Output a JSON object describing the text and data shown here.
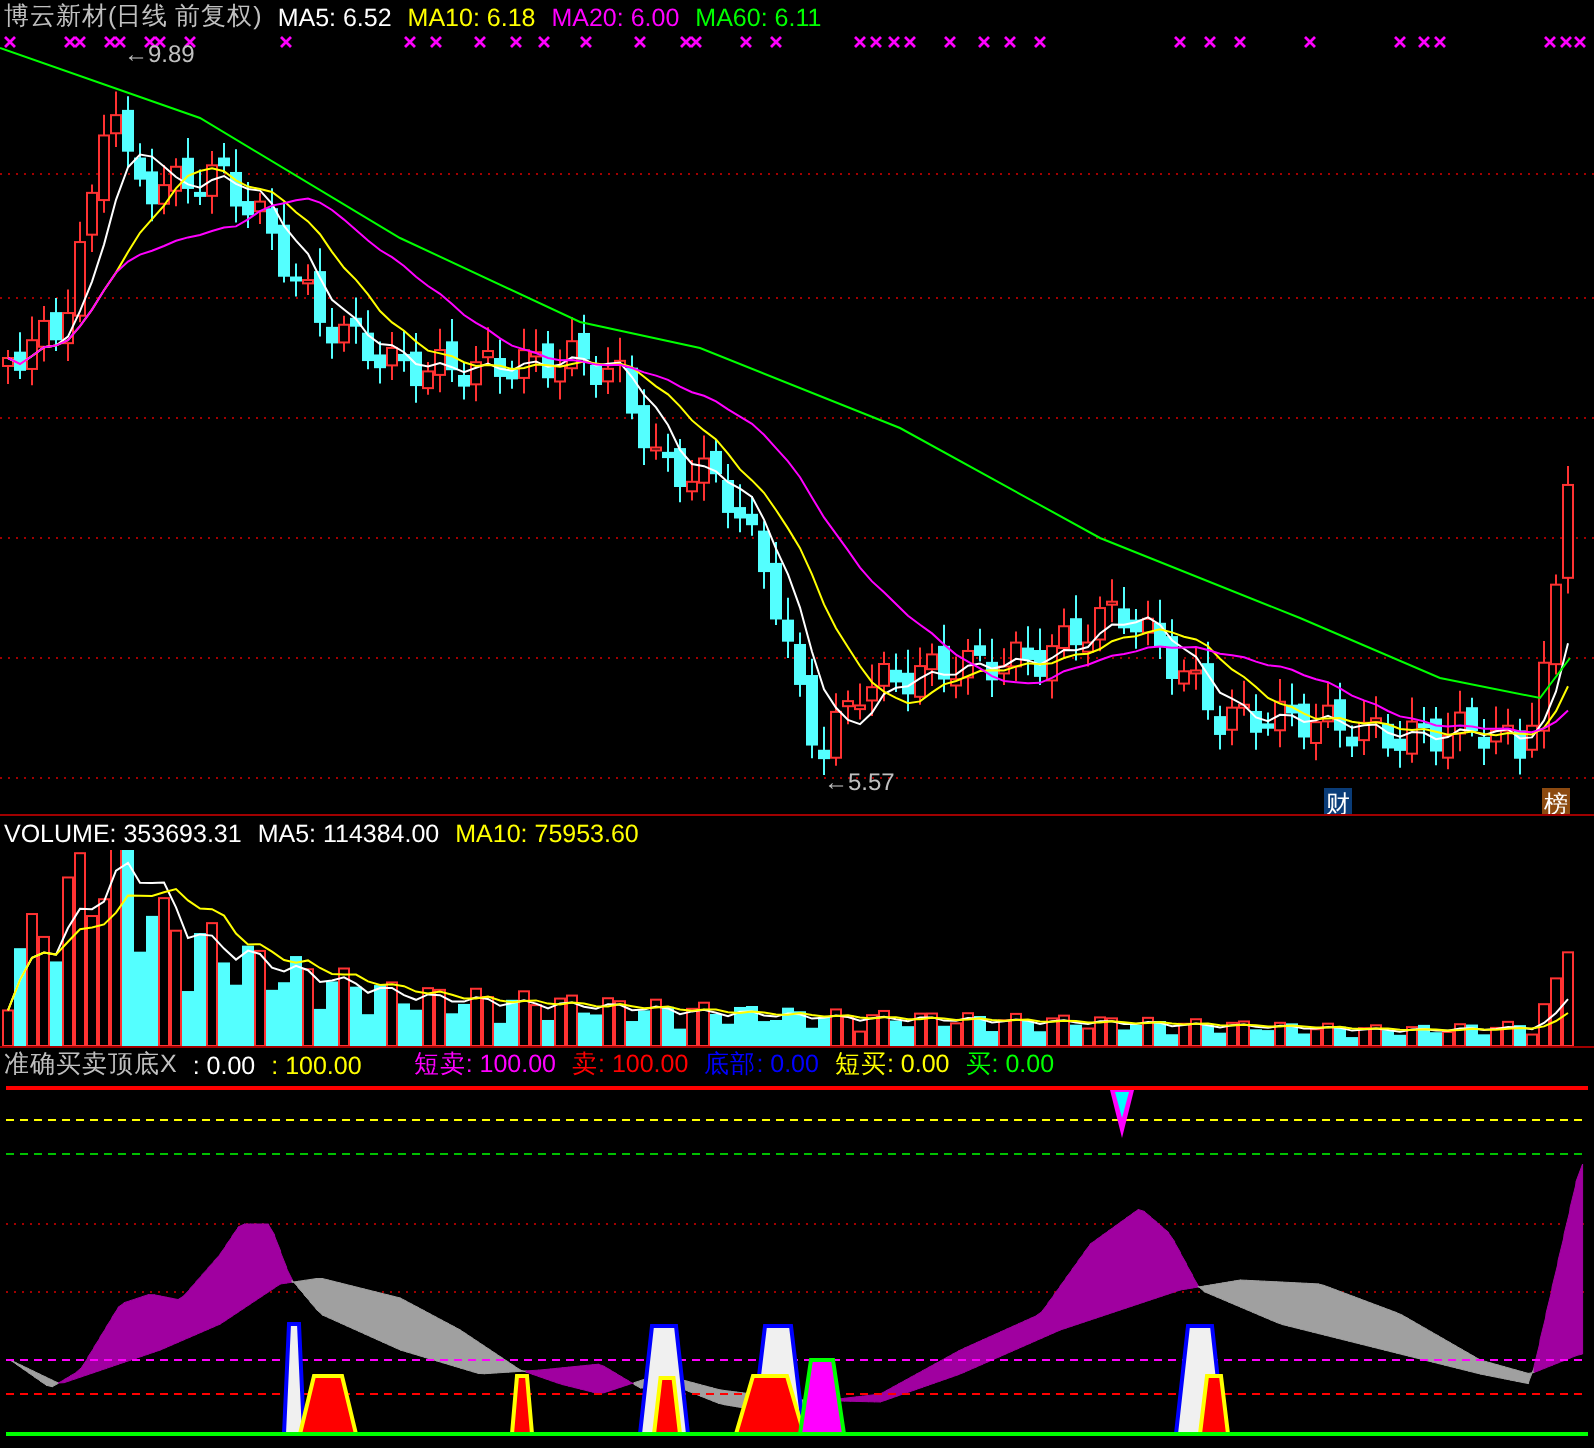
{
  "price_panel": {
    "title": "博云新材(日线 前复权)",
    "indicators": [
      {
        "label": "MA5: 6.52",
        "color": "#ffffff"
      },
      {
        "label": "MA10: 6.18",
        "color": "#ffff00"
      },
      {
        "label": "MA20: 6.00",
        "color": "#ff00ff"
      },
      {
        "label": "MA60: 6.11",
        "color": "#00ff00"
      }
    ],
    "high_label": "←9.89",
    "low_label": "←5.57",
    "badges": [
      {
        "text": "财",
        "color": "#0a3c78"
      },
      {
        "text": "榜",
        "color": "#8c4a10"
      }
    ]
  },
  "volume_panel": {
    "indicators": [
      {
        "label": "VOLUME: 353693.31",
        "color": "#ffffff"
      },
      {
        "label": "MA5: 114384.00",
        "color": "#ffffff"
      },
      {
        "label": "MA10: 75953.60",
        "color": "#ffff00"
      }
    ]
  },
  "signal_panel": {
    "title": "准确买卖顶底X",
    "indicators": [
      {
        "label": ": 0.00",
        "color": "#ffffff"
      },
      {
        "label": ": 100.00",
        "color": "#ffff00"
      },
      {
        "label": "短卖: 100.00",
        "color": "#ff00ff"
      },
      {
        "label": "卖: 100.00",
        "color": "#ff0000"
      },
      {
        "label": "底部: 0.00",
        "color": "#0000ff"
      },
      {
        "label": "短买: 0.00",
        "color": "#ffff00"
      },
      {
        "label": "买: 0.00",
        "color": "#00ff00"
      }
    ]
  }
}
